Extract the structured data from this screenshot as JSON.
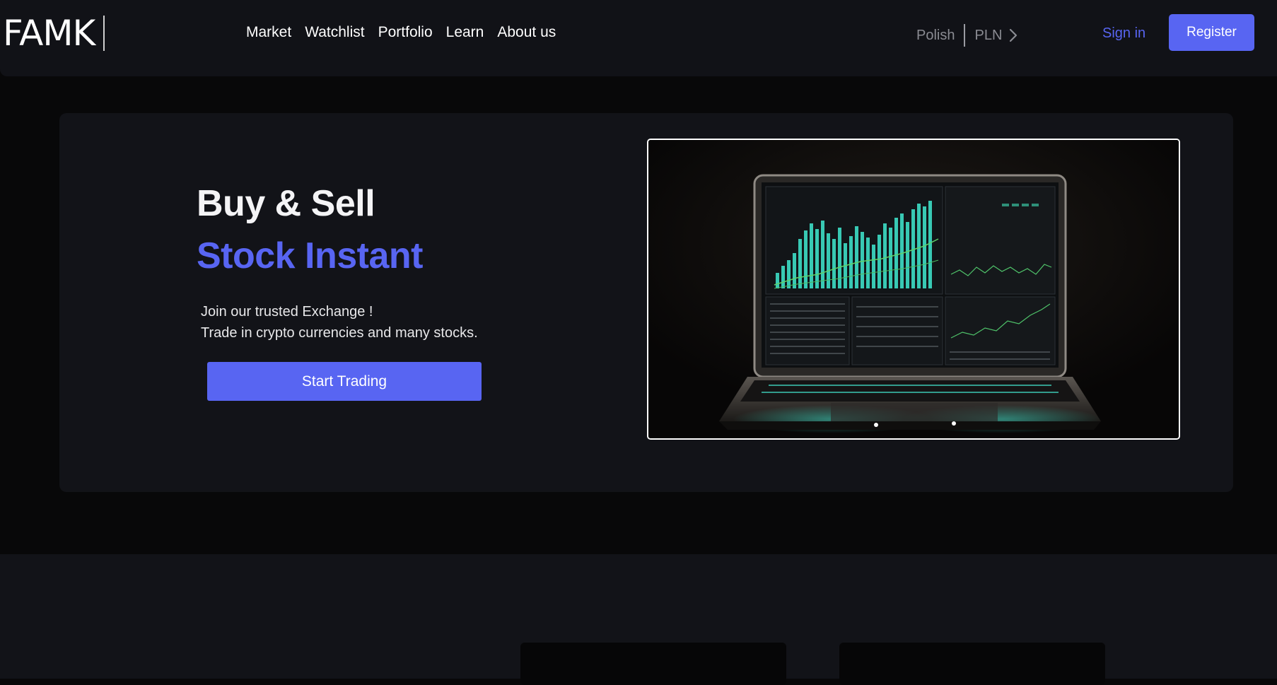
{
  "brand": {
    "name": "FAMK"
  },
  "nav": {
    "links": [
      {
        "label": "Market"
      },
      {
        "label": "Watchlist"
      },
      {
        "label": "Portfolio"
      },
      {
        "label": "Learn"
      },
      {
        "label": "About us"
      }
    ]
  },
  "locale": {
    "language": "Polish",
    "currency": "PLN",
    "icon": "chevron-right-icon"
  },
  "auth": {
    "sign_in_label": "Sign in",
    "register_label": "Register"
  },
  "hero": {
    "headline_line1": "Buy & Sell",
    "headline_line2": "Stock Instant",
    "subtext_line1": "Join our trusted Exchange !",
    "subtext_line2": "Trade in crypto currencies and many stocks.",
    "cta_label": "Start Trading"
  },
  "carousel": {
    "slide_count": 2,
    "active_index": 0
  },
  "colors": {
    "accent": "#5865f2",
    "nav_background": "#111217",
    "card_background": "#121318",
    "page_background": "#080809"
  }
}
